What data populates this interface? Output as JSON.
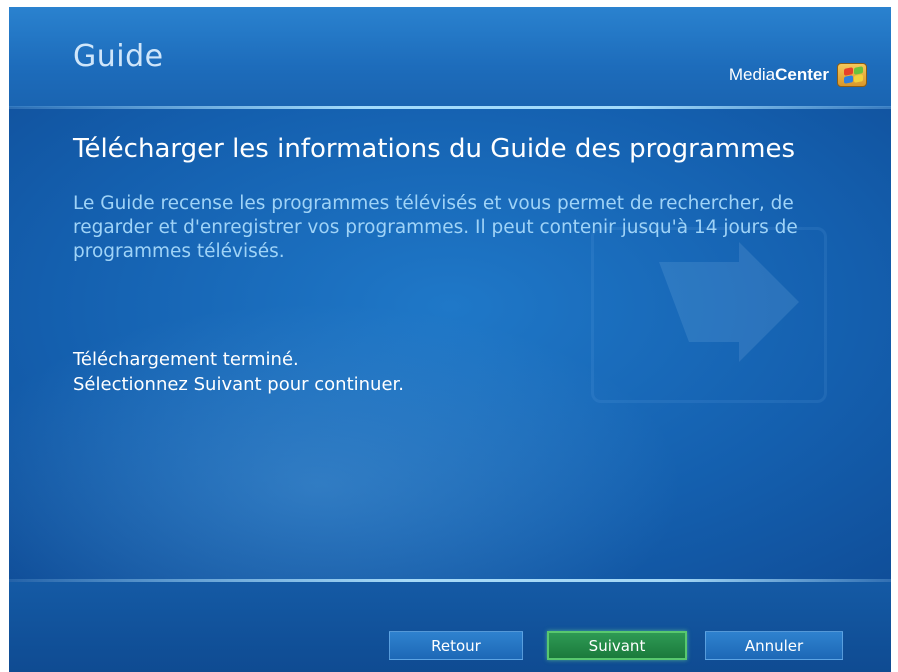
{
  "header": {
    "section_title": "Guide",
    "brand_media": "Media",
    "brand_center": "Center",
    "brand_icon": "windows-flag-icon"
  },
  "main": {
    "title": "Télécharger les informations du Guide des programmes",
    "description": "Le Guide recense les programmes télévisés et vous permet de rechercher, de regarder et d'enregistrer vos programmes. Il peut contenir jusqu'à 14 jours de programmes télévisés.",
    "status_line1": "Téléchargement terminé.",
    "status_line2": "Sélectionnez Suivant pour continuer."
  },
  "footer": {
    "back_label": "Retour",
    "next_label": "Suivant",
    "cancel_label": "Annuler"
  },
  "colors": {
    "background": "#145fae",
    "title_text": "#ffffff",
    "description_text": "#9fd3f7",
    "focused_button": "#1b7a3c",
    "focused_button_border": "#58c86e"
  }
}
